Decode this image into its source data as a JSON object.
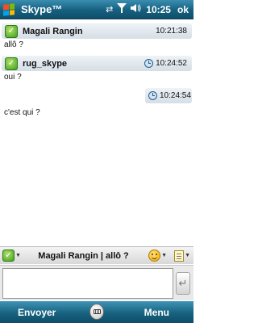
{
  "titlebar": {
    "app_title": "Skype™",
    "clock": "10:25",
    "ok_label": "ok",
    "icons": [
      "start-flag-icon",
      "sync-arrows-icon",
      "signal-icon",
      "volume-icon"
    ]
  },
  "chat": {
    "messages": [
      {
        "sender": "Magali Rangin",
        "time": "10:21:38",
        "text": "allô ?"
      },
      {
        "sender": "rug_skype",
        "time": "10:24:52",
        "text": "oui ?"
      },
      {
        "sender": "",
        "time": "10:24:54",
        "text": "c'est qui ?"
      }
    ]
  },
  "compose": {
    "conversation_title": "Magali Rangin | allô ?",
    "input_value": "",
    "input_placeholder": ""
  },
  "softkeys": {
    "left": "Envoyer",
    "right": "Menu"
  },
  "colors": {
    "titlebar": "#16607f",
    "status_green": "#3f9e1f",
    "header_bg": "#d5dee6"
  }
}
